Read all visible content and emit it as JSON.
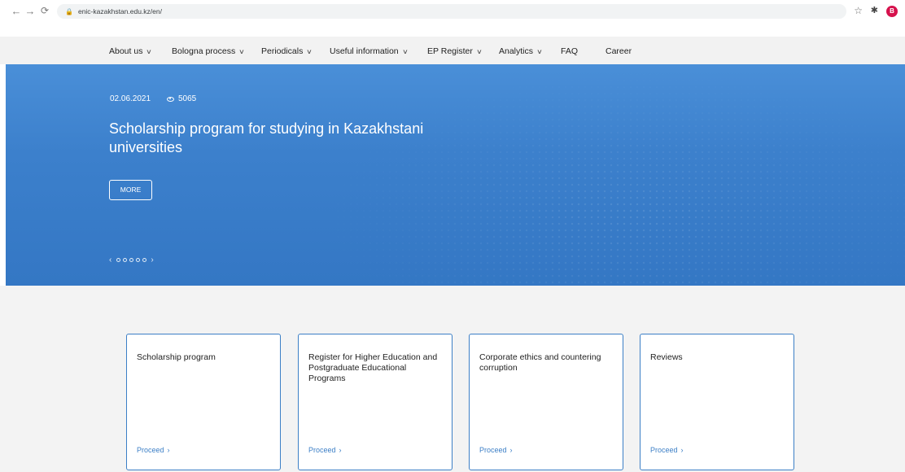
{
  "browser": {
    "url": "enic-kazakhstan.edu.kz/en/",
    "avatar_letter": "B"
  },
  "nav": {
    "items": [
      {
        "label": "About us",
        "dropdown": true
      },
      {
        "label": "Bologna process",
        "dropdown": true
      },
      {
        "label": "Periodicals",
        "dropdown": true
      },
      {
        "label": "Useful information",
        "dropdown": true
      },
      {
        "label": "EP Register",
        "dropdown": true
      },
      {
        "label": "Analytics",
        "dropdown": true
      },
      {
        "label": "FAQ",
        "dropdown": false
      },
      {
        "label": "Career",
        "dropdown": false
      }
    ]
  },
  "hero": {
    "date": "02.06.2021",
    "views": "5065",
    "title": "Scholarship program for studying in Kazakhstani universities",
    "more_label": "MORE",
    "slide_count": 5,
    "prev_icon": "‹",
    "next_icon": "›",
    "background_color": "#3a7fcb"
  },
  "cards": [
    {
      "title": "Scholarship program",
      "link": "Proceed"
    },
    {
      "title": "Register for Higher Education and Postgraduate Educational Programs",
      "link": "Proceed"
    },
    {
      "title": "Corporate ethics and countering corruption",
      "link": "Proceed"
    },
    {
      "title": "Reviews",
      "link": "Proceed"
    }
  ],
  "icons": {
    "card_link_chevron": "›",
    "nav_caret": "v"
  },
  "colors": {
    "accent": "#3c7fc6",
    "nav_background": "#f2f2f2",
    "section_background": "#f3f3f3"
  }
}
